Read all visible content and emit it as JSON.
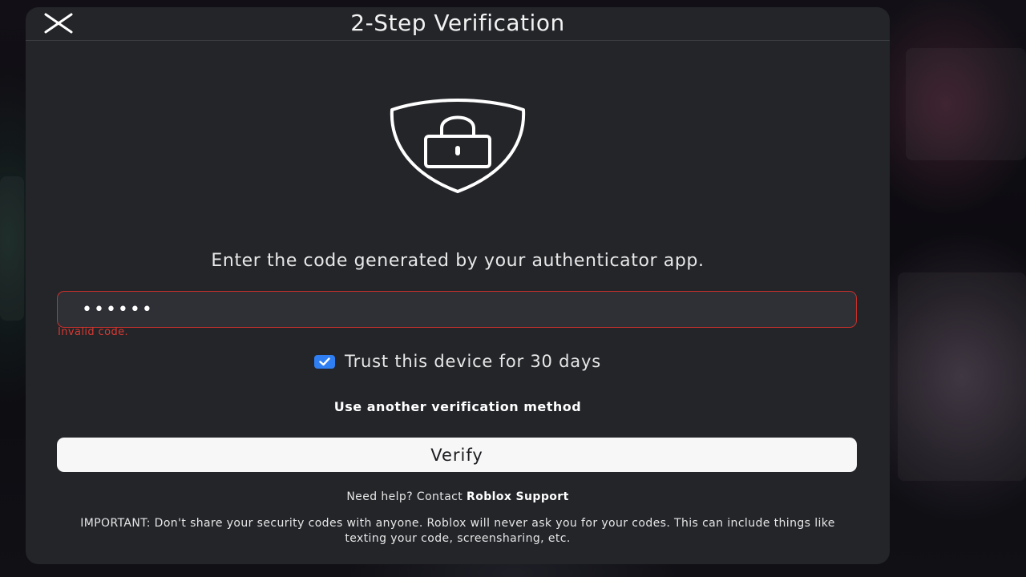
{
  "dialog": {
    "title": "2-Step Verification",
    "close_icon": "close-icon",
    "shield_icon": "shield-lock-icon",
    "instruction": "Enter the code generated by your authenticator app.",
    "code_input": {
      "value": "••••••",
      "placeholder": "",
      "error": "Invalid code."
    },
    "trust_device": {
      "checked": true,
      "label": "Trust this device for 30 days"
    },
    "alt_method_label": "Use another verification method",
    "verify_label": "Verify",
    "help": {
      "prefix": "Need help? Contact ",
      "link": "Roblox Support"
    },
    "important_notice": "IMPORTANT: Don't share your security codes with anyone. Roblox will never ask you for your codes. This can include things like texting your code, screensharing, etc."
  },
  "colors": {
    "modal_bg": "#232529",
    "error": "#d63a33",
    "checkbox": "#2f7ef2",
    "button_bg": "#f7f7f8"
  }
}
